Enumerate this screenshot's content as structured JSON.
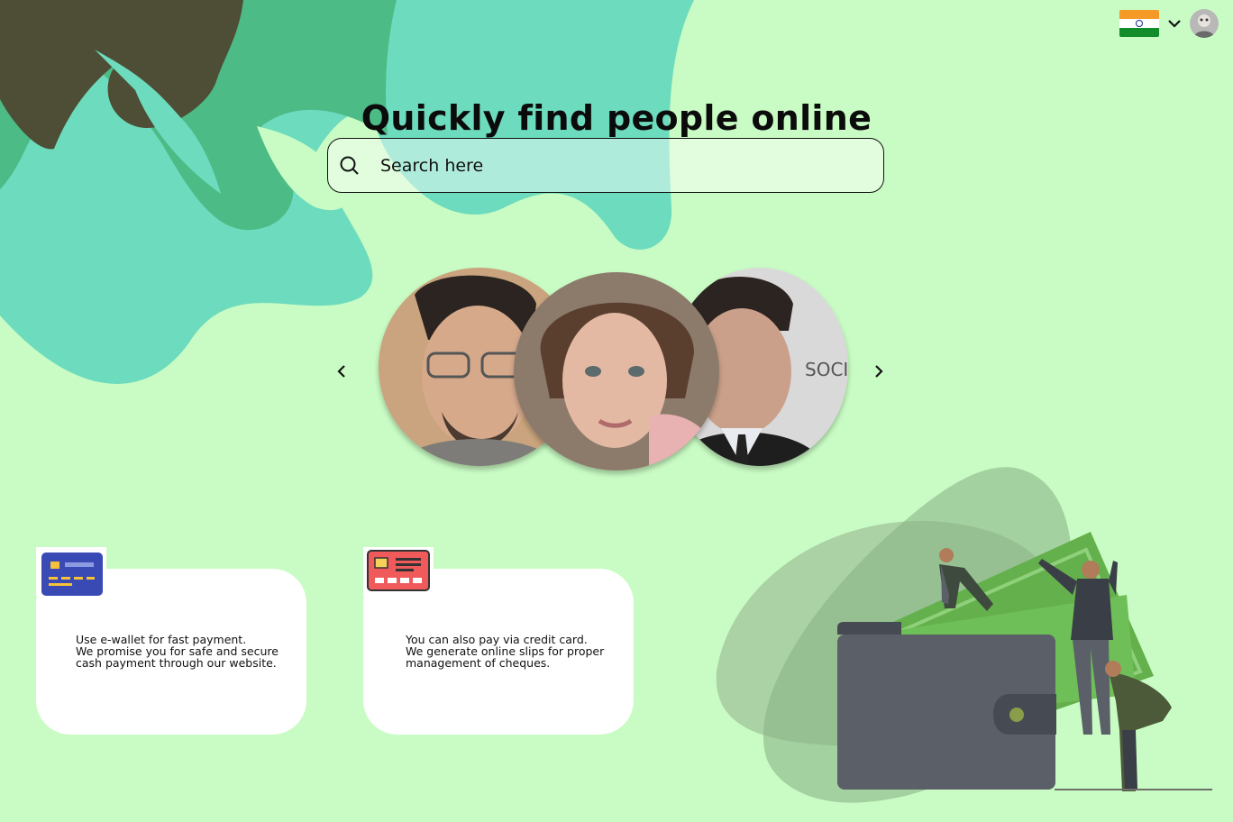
{
  "header": {
    "language_flag": "india-flag-icon",
    "dropdown_icon": "chevron-down-icon"
  },
  "hero": {
    "title": "Quickly find people online"
  },
  "search": {
    "placeholder": "Search here",
    "value": ""
  },
  "carousel": {
    "prev_icon": "chevron-left-icon",
    "next_icon": "chevron-right-icon"
  },
  "cards": [
    {
      "icon": "e-wallet-card-icon",
      "line1": "Use e-wallet for fast payment.",
      "line2": "We promise you for safe and secure",
      "line3": "cash payment through our website."
    },
    {
      "icon": "credit-card-icon",
      "line1": "You can also pay via credit card.",
      "line2": "We generate online slips for proper",
      "line3": "management of cheques."
    }
  ],
  "colors": {
    "background": "#c9fcc4",
    "blob_dark": "#4e4d35",
    "blob_green": "#4cbb86",
    "blob_teal": "#6ddbbd"
  }
}
